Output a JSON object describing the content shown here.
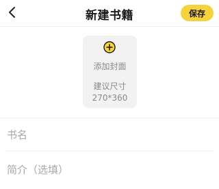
{
  "header": {
    "title": "新建书籍",
    "save_label": "保存",
    "accent_color": "#f6d33e"
  },
  "cover": {
    "add_label": "添加封面",
    "hint_line1": "建议尺寸",
    "hint_line2": "270*360"
  },
  "form": {
    "name_placeholder": "书名",
    "intro_placeholder": "简介（选填）",
    "name_value": "",
    "intro_value": ""
  },
  "icons": {
    "back": "chevron-left-icon",
    "add": "plus-circle-icon"
  }
}
